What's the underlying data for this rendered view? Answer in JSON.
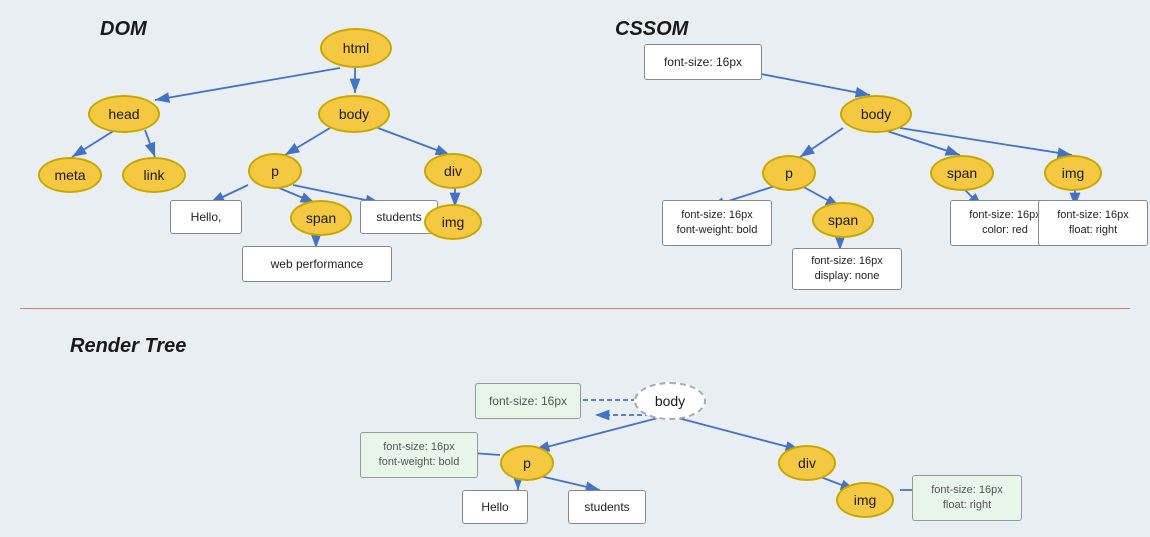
{
  "sections": {
    "dom_label": "DOM",
    "cssom_label": "CSSOM",
    "render_label": "Render Tree"
  },
  "dom": {
    "nodes": {
      "html": "html",
      "head": "head",
      "body": "body",
      "meta": "meta",
      "link": "link",
      "p": "p",
      "span": "span",
      "div": "div",
      "img": "img"
    },
    "rects": {
      "hello": "Hello,",
      "students": "students",
      "web_performance": "web performance"
    }
  },
  "cssom": {
    "nodes": {
      "body": "body",
      "p": "p",
      "span1": "span",
      "span2": "span",
      "img": "img"
    },
    "rects": {
      "font_size_root": "font-size: 16px",
      "p_styles": "font-size: 16px\nfont-weight: bold",
      "span1_styles": "font-size: 16px\ncolor: red",
      "span2_styles": "font-size: 16px\ndisplay: none",
      "img_styles": "font-size: 16px\nfloat: right"
    }
  },
  "render": {
    "nodes": {
      "body": "body",
      "p": "p",
      "div": "div",
      "img": "img"
    },
    "rects": {
      "font_size": "font-size: 16px",
      "p_styles": "font-size: 16px\nfont-weight: bold",
      "img_styles": "font-size: 16px\nfloat: right",
      "hello": "Hello",
      "students": "students"
    }
  }
}
